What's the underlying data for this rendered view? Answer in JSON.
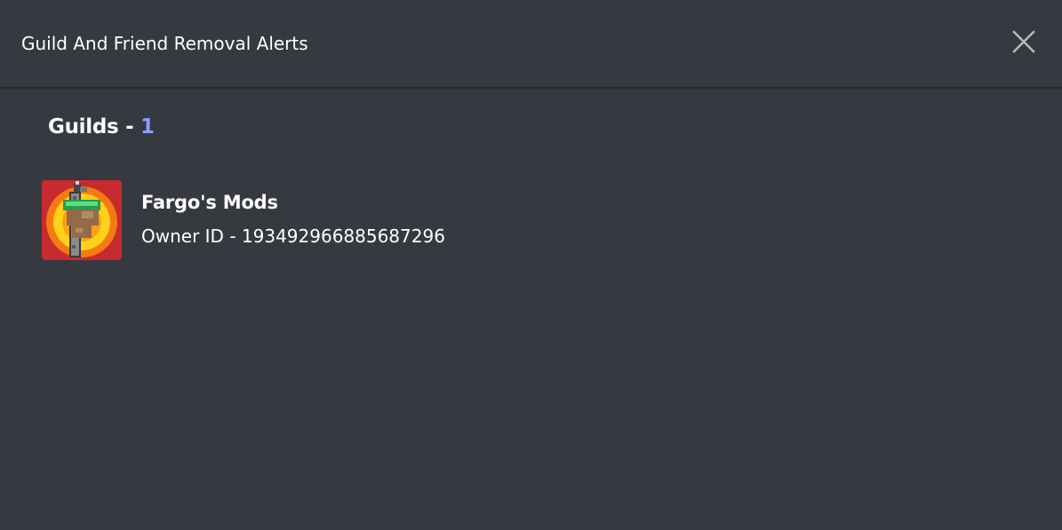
{
  "modal": {
    "title": "Guild And Friend Removal Alerts",
    "close_icon": "close-icon"
  },
  "section": {
    "label": "Guilds",
    "separator": " - ",
    "count": "1"
  },
  "guilds": [
    {
      "name": "Fargo's Mods",
      "owner_prefix": "Owner ID - ",
      "owner_id": "193492966885687296",
      "icon": "guild-avatar-icon"
    }
  ],
  "colors": {
    "background": "#36393f",
    "header_border": "#26282c",
    "text": "#ffffff",
    "accent_count": "#8e9bff",
    "close_icon": "#b9bbbe"
  }
}
